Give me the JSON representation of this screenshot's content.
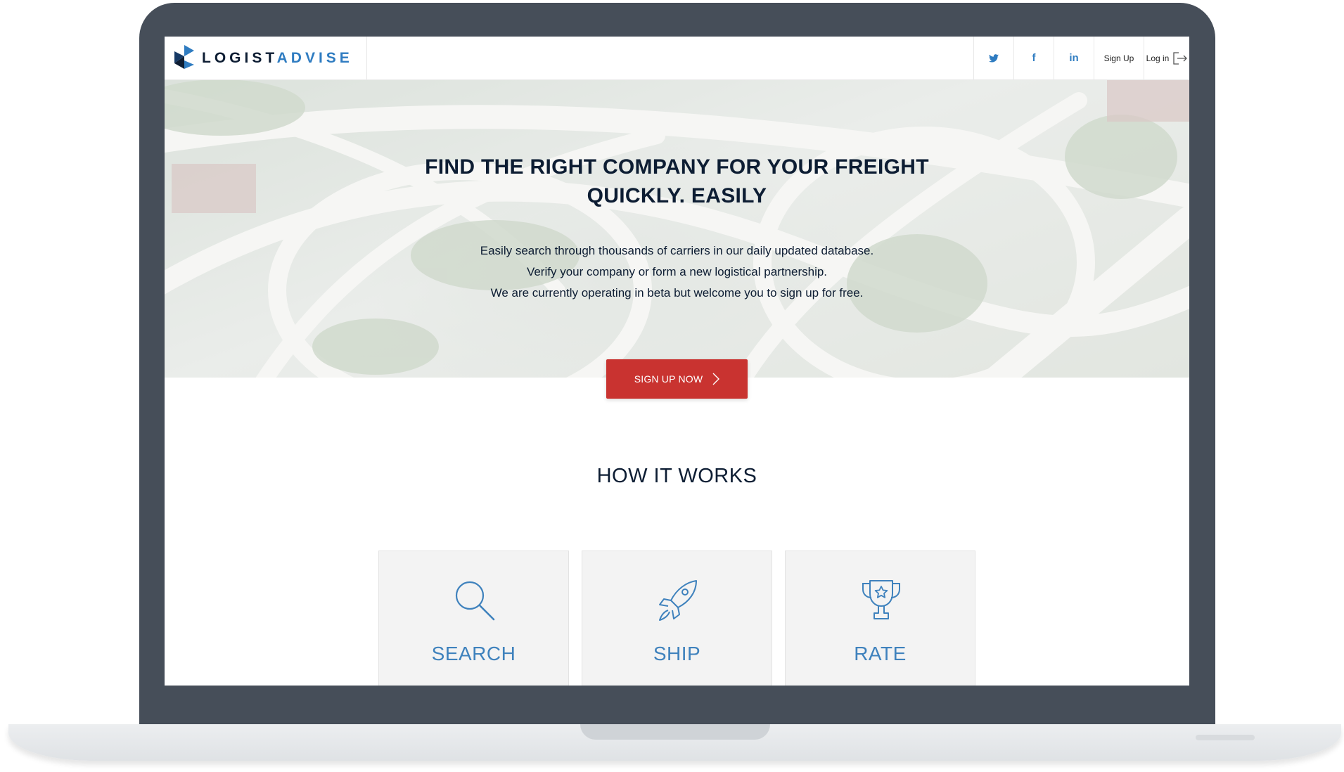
{
  "brand": {
    "name_part1": "LOGIST",
    "name_part2": "ADVISE",
    "accent_color": "#2f7cc1",
    "dark_color": "#0d1d33"
  },
  "nav": {
    "social": [
      {
        "icon": "twitter-icon",
        "glyph": "🐦︎"
      },
      {
        "icon": "facebook-icon",
        "glyph": "f"
      },
      {
        "icon": "linkedin-icon",
        "glyph": "in"
      }
    ],
    "signup_label": "Sign Up",
    "login_label": "Log in"
  },
  "hero": {
    "title_line1": "FIND THE RIGHT COMPANY FOR YOUR FREIGHT",
    "title_line2": "QUICKLY. EASILY",
    "lines": [
      "Easily search through thousands of carriers in our daily updated database.",
      "Verify your company or form a new logistical partnership.",
      "We are currently operating in beta but welcome you to sign up for free."
    ],
    "cta_label": "SIGN UP NOW",
    "cta_color": "#c93330"
  },
  "how_it_works": {
    "title": "HOW IT WORKS",
    "cards": [
      {
        "label": "SEARCH",
        "icon": "search-icon"
      },
      {
        "label": "SHIP",
        "icon": "rocket-icon"
      },
      {
        "label": "RATE",
        "icon": "trophy-icon"
      }
    ]
  }
}
